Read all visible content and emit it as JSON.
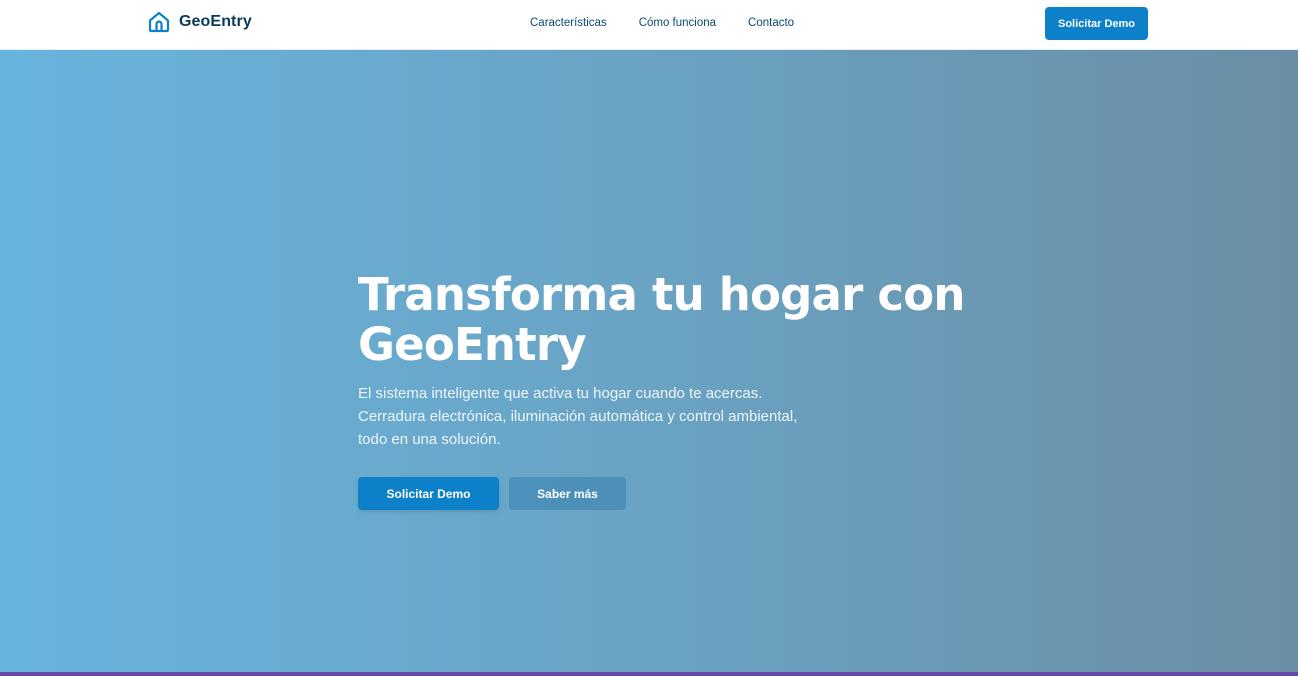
{
  "header": {
    "brand_name": "GeoEntry",
    "brand_icon": "home-icon",
    "nav": [
      {
        "label": "Características"
      },
      {
        "label": "Cómo funciona"
      },
      {
        "label": "Contacto"
      }
    ],
    "cta_label": "Solicitar Demo"
  },
  "hero": {
    "title": "Transforma tu hogar con GeoEntry",
    "subtitle": "El sistema inteligente que activa tu hogar cuando te acercas. Cerradura electrónica, iluminación automática y control ambiental, todo en una solución.",
    "primary_button": "Solicitar Demo",
    "secondary_button": "Saber más"
  },
  "colors": {
    "accent": "#0c80c8",
    "brand_text": "#0a3a5c",
    "hero_gradient_start": "#67b4de",
    "hero_gradient_end": "#6a8ea5"
  }
}
